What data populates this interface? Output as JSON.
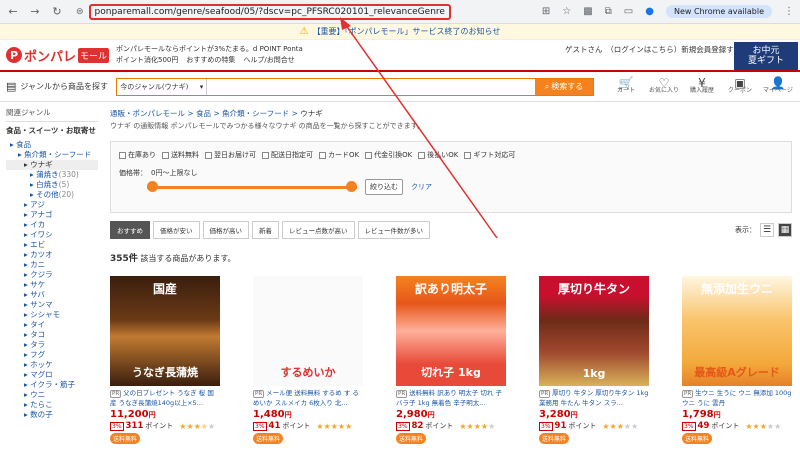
{
  "browser": {
    "url": "ponparemall.com/genre/seafood/05/?dscv=pc_PFSRC020101_relevanceGenre",
    "new_chrome": "New Chrome available"
  },
  "notice": {
    "text": "【重要】「ポンパレモール」サービス終了のお知らせ"
  },
  "header": {
    "logo": "ポンパレ",
    "logo_suffix": "モール",
    "tagline": "ポンパレモールならポイントが3%たまる。d POINT Ponta",
    "links": [
      "ポイント消化500円",
      "おすすめの特集",
      "ヘルプ/お問合せ"
    ],
    "guest": "ゲストさん　（ログインはこちら）新規会員登録する",
    "banner": "お中元\n夏ギフト"
  },
  "search": {
    "genre_label": "ジャンルから商品を探す",
    "select_value": "今のジャンル(ウナギ)",
    "button": "検索する",
    "icons": [
      {
        "name": "cart",
        "glyph": "🛒",
        "label": "カート"
      },
      {
        "name": "favorite",
        "glyph": "♡",
        "label": "お気に入り"
      },
      {
        "name": "history",
        "glyph": "¥",
        "label": "購入履歴"
      },
      {
        "name": "coupon",
        "glyph": "▣",
        "label": "クーポン"
      },
      {
        "name": "mypage",
        "glyph": "👤",
        "label": "マイページ"
      }
    ]
  },
  "sidebar": {
    "title": "関連ジャンル",
    "sub": "食品・スイーツ・お取寄せ",
    "items": [
      {
        "label": "食品",
        "level": 1
      },
      {
        "label": "魚介類・シーフード",
        "level": 2
      },
      {
        "label": "ウナギ",
        "level": 3,
        "selected": true
      },
      {
        "label": "蒲焼き",
        "count": "(330)",
        "level": 4
      },
      {
        "label": "白焼き",
        "count": "(5)",
        "level": 4
      },
      {
        "label": "その他",
        "count": "(20)",
        "level": 4
      },
      {
        "label": "アジ",
        "level": 3
      },
      {
        "label": "アナゴ",
        "level": 3
      },
      {
        "label": "イカ",
        "level": 3
      },
      {
        "label": "イワシ",
        "level": 3
      },
      {
        "label": "エビ",
        "level": 3
      },
      {
        "label": "カツオ",
        "level": 3
      },
      {
        "label": "カニ",
        "level": 3
      },
      {
        "label": "クジラ",
        "level": 3
      },
      {
        "label": "サケ",
        "level": 3
      },
      {
        "label": "サバ",
        "level": 3
      },
      {
        "label": "サンマ",
        "level": 3
      },
      {
        "label": "シシャモ",
        "level": 3
      },
      {
        "label": "タイ",
        "level": 3
      },
      {
        "label": "タコ",
        "level": 3
      },
      {
        "label": "タラ",
        "level": 3
      },
      {
        "label": "フグ",
        "level": 3
      },
      {
        "label": "ホッケ",
        "level": 3
      },
      {
        "label": "マグロ",
        "level": 3
      },
      {
        "label": "イクラ・筋子",
        "level": 3
      },
      {
        "label": "ウニ",
        "level": 3
      },
      {
        "label": "たらこ",
        "level": 3
      },
      {
        "label": "数の子",
        "level": 3
      }
    ]
  },
  "breadcrumb": {
    "items": [
      "通販・ポンパレモール",
      "食品",
      "魚介類・シーフード"
    ],
    "current": "ウナギ"
  },
  "description": "ウナギ の通販情報 ポンパレモールでみつかる様々なウナギ の商品を一覧から探すことができます。",
  "filters": {
    "checks": [
      "在庫あり",
      "送料無料",
      "翌日お届け可",
      "配送日指定可",
      "カードOK",
      "代金引換OK",
      "後払いOK",
      "ギフト対応可"
    ],
    "price_label": "価格帯：",
    "price_value": "0円～上限なし",
    "apply": "絞り込む",
    "clear": "クリア"
  },
  "sort": {
    "buttons": [
      "おすすめ",
      "価格が安い",
      "価格が高い",
      "新着",
      "レビュー点数が高い",
      "レビュー件数が多い"
    ],
    "active": 0,
    "view_label": "表示："
  },
  "result": {
    "count": "355件",
    "suffix": "該当する商品があります。"
  },
  "products": [
    {
      "thumb_top": "国産",
      "thumb_cap": "うなぎ長蒲焼",
      "pr": "PR",
      "title": "父の日プレゼント うなぎ 桜 国産 うなぎ長蒲焼140g以上×5...",
      "price": "11,200",
      "yen": "円",
      "pct": "3%",
      "points": "311",
      "pt_label": "ポイント",
      "rating": 3.5,
      "ship": "送料無料"
    },
    {
      "thumb_top": "",
      "thumb_cap": "するめいか",
      "pr": "PR",
      "title": "メール便 送料無料 するめ す るめいか スルメイカ 6枚入り 北...",
      "price": "1,480",
      "yen": "円",
      "pct": "3%",
      "points": "41",
      "pt_label": "ポイント",
      "rating": 5,
      "ship": "送料無料"
    },
    {
      "thumb_top": "訳あり明太子",
      "thumb_cap": "切れ子 1kg",
      "pr": "PR",
      "title": "送料無料 訳あり 明太子 切れ 子 バラ子 1kg 無着色 辛子明太...",
      "price": "2,980",
      "yen": "円",
      "pct": "3%",
      "points": "82",
      "pt_label": "ポイント",
      "rating": 4,
      "ship": "送料無料"
    },
    {
      "thumb_top": "厚切り牛タン",
      "thumb_cap": "1kg",
      "pr": "PR",
      "title": "厚切り 牛タン 厚切り牛タン 1kg 業務用 牛たん 牛タン スラ...",
      "price": "3,280",
      "yen": "円",
      "pct": "3%",
      "points": "91",
      "pt_label": "ポイント",
      "rating": 3,
      "ship": "送料無料"
    },
    {
      "thumb_top": "無添加生ウニ",
      "thumb_cap": "最高級Aグレード",
      "pr": "PR",
      "title": "生ウニ 生うに ウニ 無添加 100g ウニ うに 雲丹",
      "price": "1,798",
      "yen": "円",
      "pct": "3%",
      "points": "49",
      "pt_label": "ポイント",
      "rating": 3,
      "ship": "送料無料"
    }
  ],
  "colors": {
    "brand": "#e03030",
    "accent": "#f58220",
    "highlight": "#e03030"
  }
}
